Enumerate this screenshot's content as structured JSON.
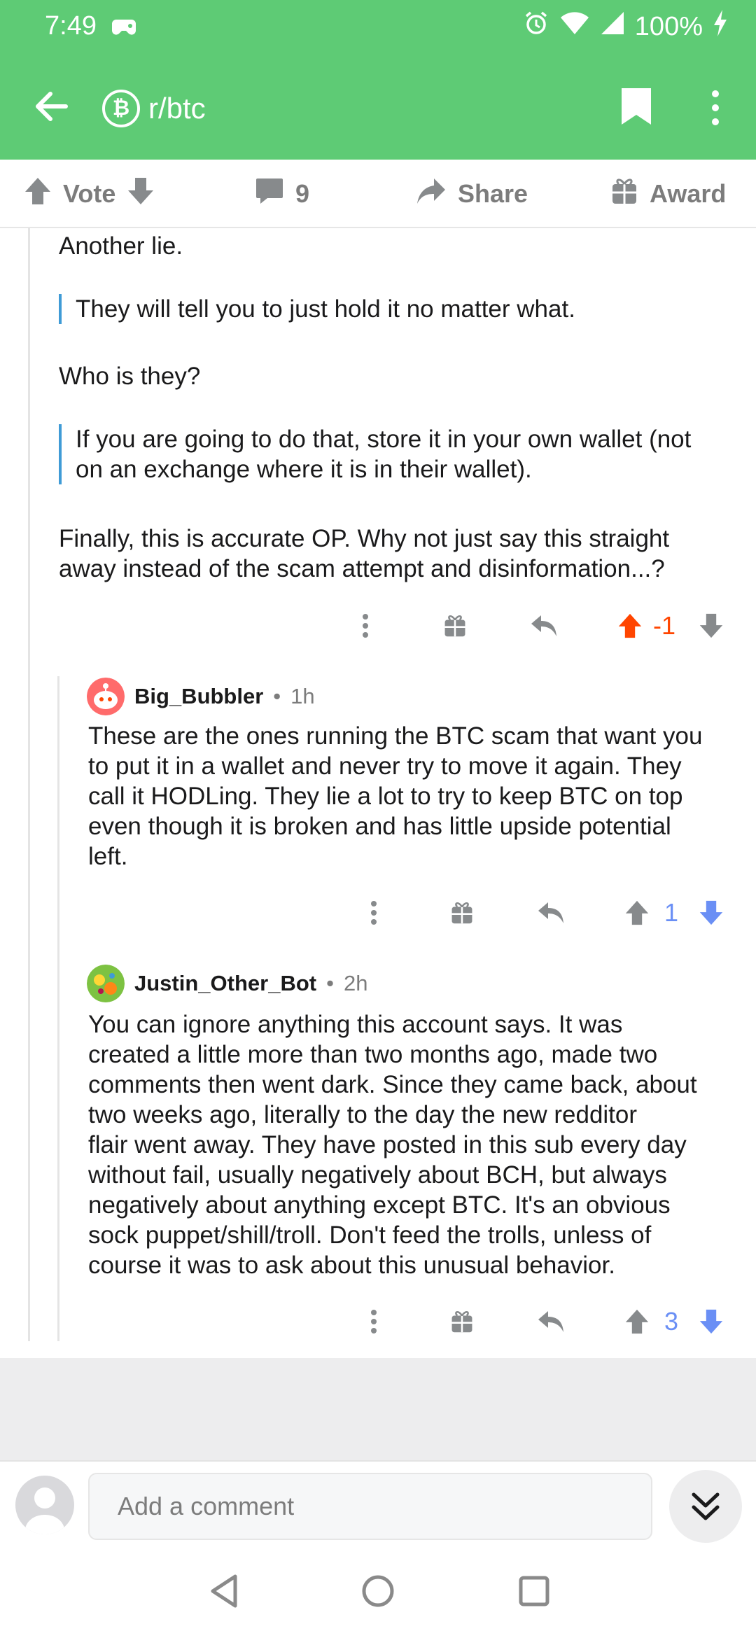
{
  "status": {
    "time": "7:49",
    "battery": "100%"
  },
  "header": {
    "subreddit": "r/btc",
    "sub_icon_char": "₿"
  },
  "post_actions": {
    "vote_label": "Vote",
    "comment_count": "9",
    "share_label": "Share",
    "award_label": "Award"
  },
  "parent_comment": {
    "p1": "Another lie.",
    "quote1": "They will tell you to just hold it no matter what.",
    "p2": "Who is they?",
    "quote2_line1": "If you are going to do that, store it in your own wallet (not",
    "quote2_line2": "on an exchange where it is in their wallet).",
    "p3_line1": "Finally, this is accurate OP.  Why not just say this straight",
    "p3_line2": "away instead of the scam attempt and disinformation...?",
    "score": "-1"
  },
  "replies": [
    {
      "author": "Big_Bubbler",
      "time": "1h",
      "lines": [
        "These are the ones running the BTC scam that want you",
        "to put it in a wallet and never try to move it again. They",
        "call it HODLing. They lie a lot to try to keep BTC on top",
        "even though it is broken and has little upside potential",
        "left."
      ],
      "score": "1"
    },
    {
      "author": "Justin_Other_Bot",
      "time": "2h",
      "lines": [
        "You can ignore anything this account says. It was",
        "created a little more than two months ago, made two",
        "comments then went dark. Since they came back, about",
        "two weeks ago, literally to the day the new redditor",
        "flair went away. They have posted in this sub every day",
        "without fail, usually negatively about BCH, but always",
        "negatively about anything except BTC. It's an obvious",
        "sock puppet/shill/troll. Don't feed the trolls, unless of",
        "course it was to ask about this unusual behavior."
      ],
      "score": "3"
    }
  ],
  "separator": "•",
  "composer": {
    "placeholder": "Add a comment"
  },
  "colors": {
    "brand": "#5ecb75",
    "upvote": "#ff4500",
    "downvote": "#6a8ff5",
    "icon_gray": "#878a8c",
    "quote_bar": "#3f9bd6"
  }
}
